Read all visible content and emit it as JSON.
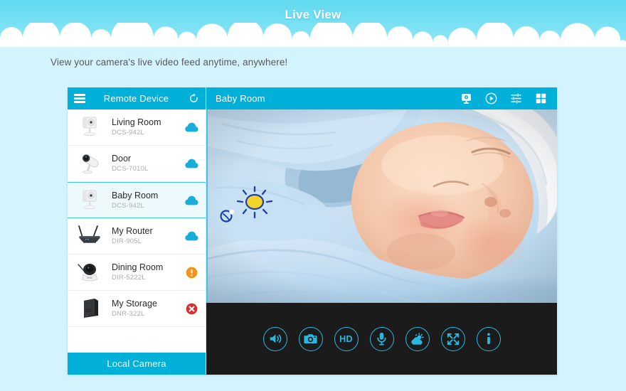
{
  "header": {
    "title": "Live View",
    "subtitle": "View your camera's live video feed anytime, anywhere!"
  },
  "colors": {
    "sky_top": "#5fd9ef",
    "sky_bottom": "#8fe7f6",
    "page_background": "#d3f4fc",
    "accent": "#00b0d8",
    "selected_row": "#eef9fc",
    "selected_border": "#3dc6e4",
    "control_bar": "#1b1b1b",
    "control_icon": "#2bb8e0",
    "status_cloud": "#17aedb",
    "status_warning": "#f5921e",
    "status_error": "#e02b2b"
  },
  "sidebar": {
    "menu_icon": "hamburger-icon",
    "title": "Remote Device",
    "refresh_icon": "refresh-icon",
    "footer_button": "Local Camera",
    "devices": [
      {
        "name": "Living Room",
        "model": "DCS-942L",
        "thumb": "cube-camera",
        "status": "cloud",
        "selected": false
      },
      {
        "name": "Door",
        "model": "DCS-7010L",
        "thumb": "bullet-camera",
        "status": "cloud",
        "selected": false
      },
      {
        "name": "Baby Room",
        "model": "DCS-942L",
        "thumb": "cube-camera",
        "status": "cloud",
        "selected": true
      },
      {
        "name": "My Router",
        "model": "DIR-905L",
        "thumb": "router",
        "status": "cloud",
        "selected": false
      },
      {
        "name": "Dining Room",
        "model": "DIR-5222L",
        "thumb": "pantilt-camera",
        "status": "warning",
        "selected": false
      },
      {
        "name": "My Storage",
        "model": "DNR-322L",
        "thumb": "nas-storage",
        "status": "error",
        "selected": false
      }
    ]
  },
  "video": {
    "title": "Baby Room",
    "header_icons": [
      {
        "name": "camera-device-icon",
        "label": "Camera"
      },
      {
        "name": "play-circle-icon",
        "label": "Play"
      },
      {
        "name": "settings-sliders-icon",
        "label": "Settings"
      },
      {
        "name": "grid-view-icon",
        "label": "Grid View"
      }
    ],
    "scene": "sleeping baby in light blue clothing with white hat",
    "controls": [
      {
        "name": "speaker-icon",
        "label": "Speaker"
      },
      {
        "name": "snapshot-camera-icon",
        "label": "Snapshot"
      },
      {
        "name": "hd-label",
        "label": "HD"
      },
      {
        "name": "microphone-icon",
        "label": "Microphone"
      },
      {
        "name": "weather-icon",
        "label": "Weather"
      },
      {
        "name": "fullscreen-icon",
        "label": "Fullscreen"
      },
      {
        "name": "info-icon",
        "label": "Info"
      }
    ]
  }
}
